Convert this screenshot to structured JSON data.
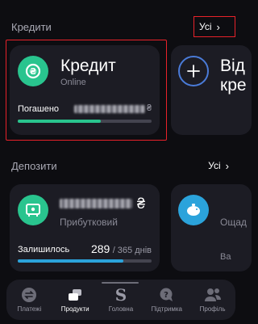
{
  "credits": {
    "title": "Кредити",
    "all_label": "Усі",
    "card": {
      "name": "Кредит",
      "subtitle": "Online",
      "repaid_label": "Погашено",
      "currency": "₴",
      "progress": 0.62
    },
    "add_card": {
      "title_line1": "Від",
      "title_line2": "кре"
    }
  },
  "deposits": {
    "title": "Депозити",
    "all_label": "Усі",
    "card": {
      "currency": "₴",
      "subtitle": "Прибутковий",
      "remaining_label": "Залишилось",
      "days_done": "289",
      "days_total": "/ 365 днів",
      "progress": 0.79
    },
    "savings_card": {
      "subtitle": "Ощад",
      "meta": "Ва"
    }
  },
  "nav": {
    "items": [
      {
        "label": "Платежі",
        "icon": "transfer-icon"
      },
      {
        "label": "Продукти",
        "icon": "products-icon"
      },
      {
        "label": "Головна",
        "icon": "home-s-icon"
      },
      {
        "label": "Підтримка",
        "icon": "support-icon"
      },
      {
        "label": "Профіль",
        "icon": "profile-icon"
      }
    ],
    "active": "Продукти"
  },
  "colors": {
    "accent_green": "#29c48e",
    "accent_blue": "#2ba3db",
    "highlight_red": "#e8222a"
  }
}
